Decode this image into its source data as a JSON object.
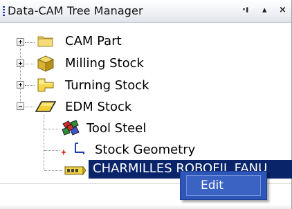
{
  "window": {
    "title": "Data-CAM Tree Manager",
    "pin_glyph": "·ı",
    "menu_glyph": "▴",
    "close_glyph": "×"
  },
  "tree": {
    "items": [
      {
        "label": "CAM Part",
        "icon": "folder-icon",
        "expander": "+"
      },
      {
        "label": "Milling Stock",
        "icon": "cube-icon",
        "expander": "+"
      },
      {
        "label": "Turning Stock",
        "icon": "turning-stock-icon",
        "expander": "+"
      },
      {
        "label": "EDM Stock",
        "icon": "edm-plate-icon",
        "expander": "−"
      },
      {
        "label": "Tool Steel",
        "icon": "material-icon"
      },
      {
        "label": "Stock Geometry",
        "icon": "stock-geometry-icon"
      },
      {
        "label": "CHARMILLES ROBOFIL FANU",
        "icon": "machine-icon",
        "selected": true
      }
    ]
  },
  "context_menu": {
    "items": [
      {
        "label": "Edit"
      }
    ]
  },
  "colors": {
    "selection": "#0a246a",
    "menu_background": "#2d56b8",
    "menu_item": "#3b63c4"
  }
}
